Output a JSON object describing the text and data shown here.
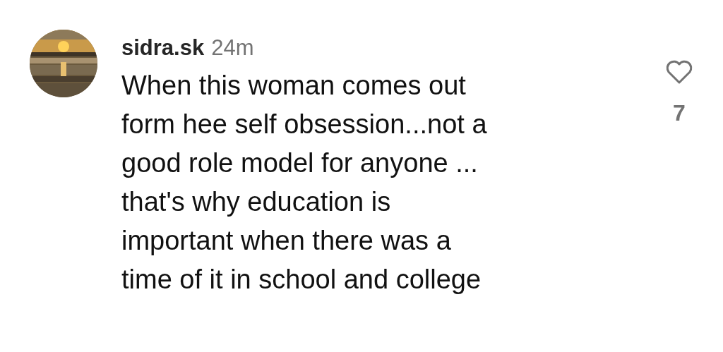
{
  "comment": {
    "username": "sidra.sk",
    "time": "24m",
    "text": "When this woman comes out\nform hee self obsession...not a\ngood role model for anyone ...\nthat's why education is\nimportant when there was a\ntime of it in school and college",
    "like": {
      "liked": false,
      "count": "7"
    }
  }
}
